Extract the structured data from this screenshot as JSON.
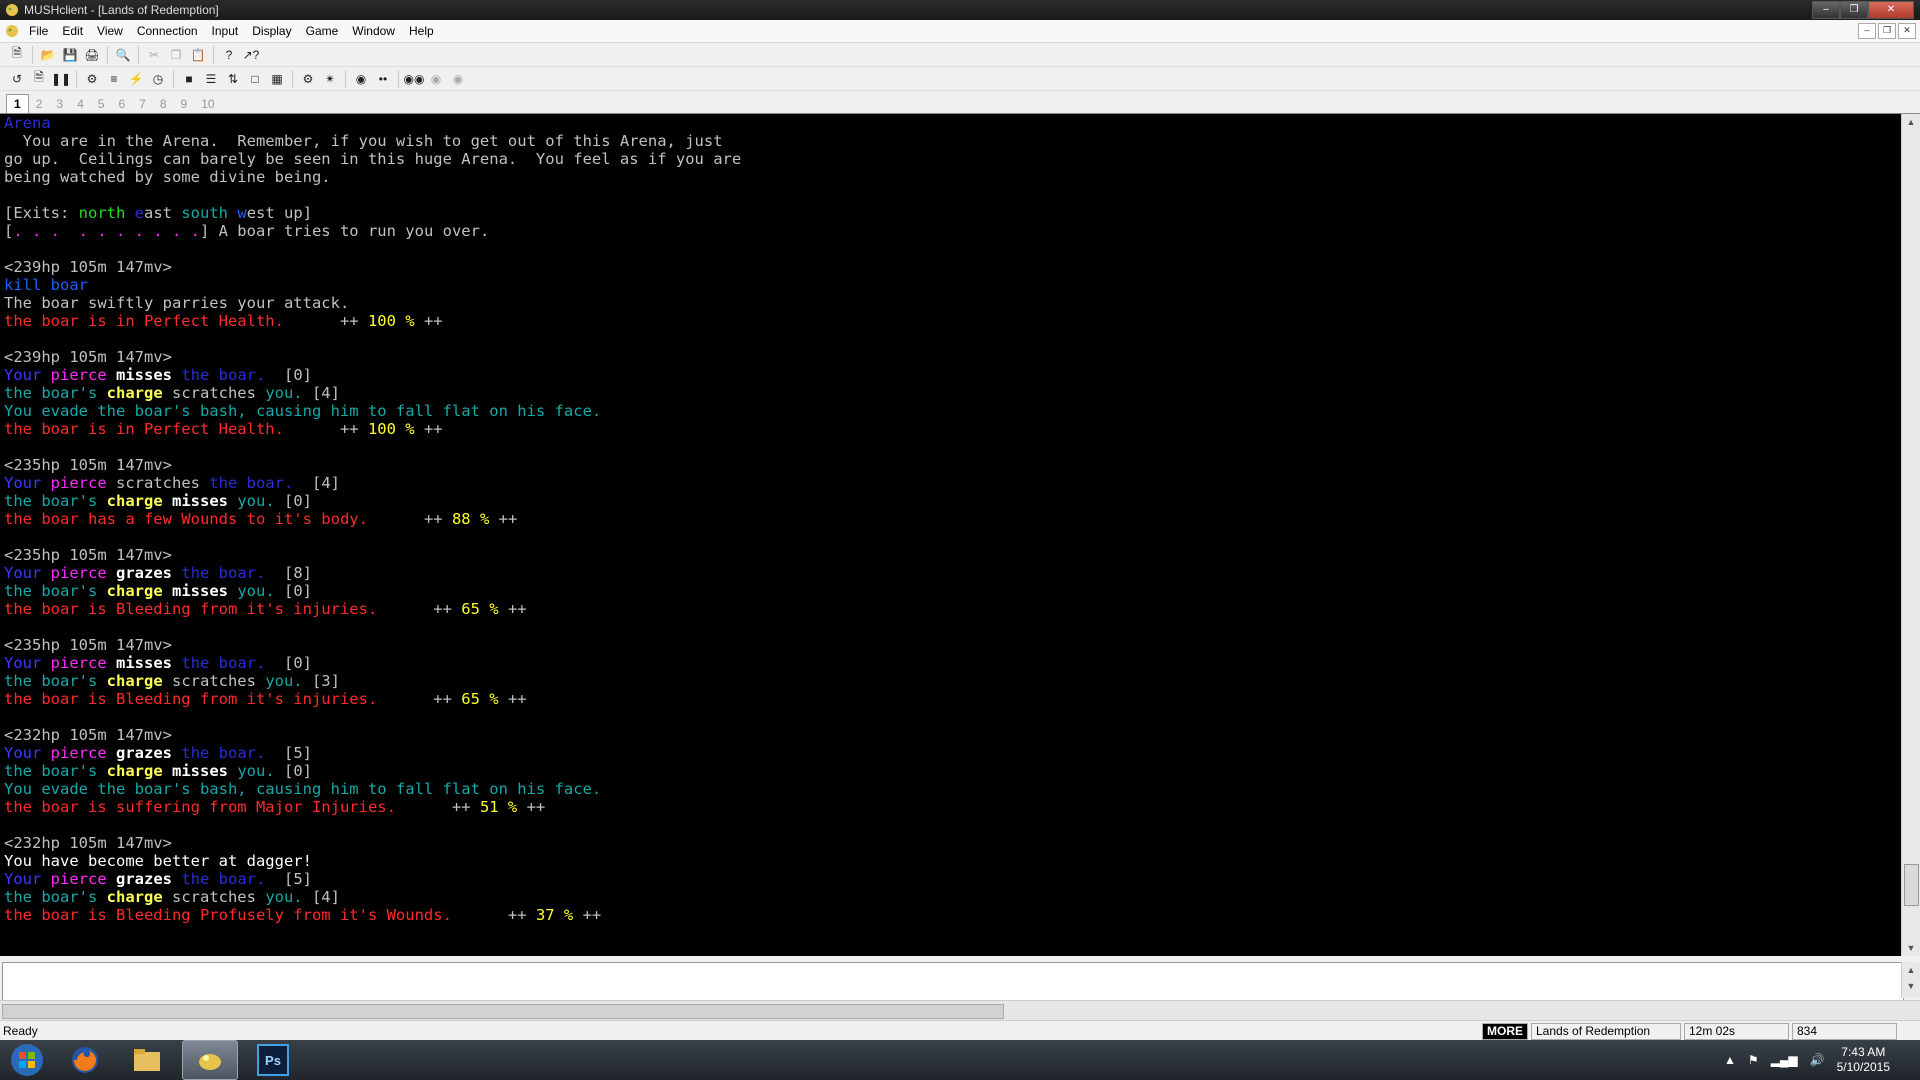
{
  "window": {
    "title": "MUSHclient - [Lands of Redemption]"
  },
  "menu": [
    "File",
    "Edit",
    "View",
    "Connection",
    "Input",
    "Display",
    "Game",
    "Window",
    "Help"
  ],
  "tabs": [
    "1",
    "2",
    "3",
    "4",
    "5",
    "6",
    "7",
    "8",
    "9",
    "10"
  ],
  "output_lines": [
    [
      [
        "Arena",
        "db"
      ]
    ],
    [
      [
        "  You are in the Arena.  Remember, if you wish to get out of this Arena, just",
        "w"
      ]
    ],
    [
      [
        "go up.  Ceilings can barely be seen in this huge Arena.  You feel as if you are",
        "w"
      ]
    ],
    [
      [
        "being watched by some divine being.",
        "w"
      ]
    ],
    [
      [
        "",
        ""
      ]
    ],
    [
      [
        "[Exits: ",
        "w"
      ],
      [
        "north",
        "g"
      ],
      [
        " ",
        "w"
      ],
      [
        "e",
        "db"
      ],
      [
        "ast ",
        "w"
      ],
      [
        "south",
        "c"
      ],
      [
        " ",
        "w"
      ],
      [
        "w",
        "b"
      ],
      [
        "est up]",
        "w"
      ]
    ],
    [
      [
        "[",
        "w"
      ],
      [
        ". . .  . . . . . . .",
        "m"
      ],
      [
        "] A boar tries to run you over.",
        "w"
      ]
    ],
    [
      [
        "",
        ""
      ]
    ],
    [
      [
        "<239hp 105m 147mv>",
        "w"
      ]
    ],
    [
      [
        "kill boar",
        "b"
      ]
    ],
    [
      [
        "The boar swiftly parries your attack.",
        "w"
      ]
    ],
    [
      [
        "the boar is in Perfect Health.",
        "r"
      ],
      [
        "      ++ ",
        "w"
      ],
      [
        "100 %",
        "y"
      ],
      [
        " ++",
        "w"
      ]
    ],
    [
      [
        "",
        ""
      ]
    ],
    [
      [
        "<239hp 105m 147mv>",
        "w"
      ]
    ],
    [
      [
        "Your ",
        "B"
      ],
      [
        "pierce",
        "m"
      ],
      [
        " ",
        "w"
      ],
      [
        "misses",
        "bw"
      ],
      [
        " ",
        "w"
      ],
      [
        "the boar.",
        "db"
      ],
      [
        "  [0]",
        "w"
      ]
    ],
    [
      [
        "the boar's ",
        "c"
      ],
      [
        "charge",
        "yw"
      ],
      [
        " scratches ",
        "w"
      ],
      [
        "you.",
        "c"
      ],
      [
        " [4]",
        "w"
      ]
    ],
    [
      [
        "You evade the boar's bash, causing him to fall flat on his face.",
        "c"
      ]
    ],
    [
      [
        "the boar is in Perfect Health.",
        "r"
      ],
      [
        "      ++ ",
        "w"
      ],
      [
        "100 %",
        "y"
      ],
      [
        " ++",
        "w"
      ]
    ],
    [
      [
        "",
        ""
      ]
    ],
    [
      [
        "<235hp 105m 147mv>",
        "w"
      ]
    ],
    [
      [
        "Your ",
        "B"
      ],
      [
        "pierce",
        "m"
      ],
      [
        " scratches ",
        "w"
      ],
      [
        "the boar.",
        "db"
      ],
      [
        "  [4]",
        "w"
      ]
    ],
    [
      [
        "the boar's ",
        "c"
      ],
      [
        "charge",
        "yw"
      ],
      [
        " ",
        "w"
      ],
      [
        "misses",
        "bw"
      ],
      [
        " ",
        "w"
      ],
      [
        "you.",
        "c"
      ],
      [
        " [0]",
        "w"
      ]
    ],
    [
      [
        "the boar has a few Wounds to it's body.",
        "r"
      ],
      [
        "      ++ ",
        "w"
      ],
      [
        "88 %",
        "y"
      ],
      [
        " ++",
        "w"
      ]
    ],
    [
      [
        "",
        ""
      ]
    ],
    [
      [
        "<235hp 105m 147mv>",
        "w"
      ]
    ],
    [
      [
        "Your ",
        "B"
      ],
      [
        "pierce",
        "m"
      ],
      [
        " ",
        "w"
      ],
      [
        "grazes",
        "bw"
      ],
      [
        " ",
        "w"
      ],
      [
        "the boar.",
        "db"
      ],
      [
        "  [8]",
        "w"
      ]
    ],
    [
      [
        "the boar's ",
        "c"
      ],
      [
        "charge",
        "yw"
      ],
      [
        " ",
        "w"
      ],
      [
        "misses",
        "bw"
      ],
      [
        " ",
        "w"
      ],
      [
        "you.",
        "c"
      ],
      [
        " [0]",
        "w"
      ]
    ],
    [
      [
        "the boar is Bleeding from it's injuries.",
        "r"
      ],
      [
        "      ++ ",
        "w"
      ],
      [
        "65 %",
        "y"
      ],
      [
        " ++",
        "w"
      ]
    ],
    [
      [
        "",
        ""
      ]
    ],
    [
      [
        "<235hp 105m 147mv>",
        "w"
      ]
    ],
    [
      [
        "Your ",
        "B"
      ],
      [
        "pierce",
        "m"
      ],
      [
        " ",
        "w"
      ],
      [
        "misses",
        "bw"
      ],
      [
        " ",
        "w"
      ],
      [
        "the boar.",
        "db"
      ],
      [
        "  [0]",
        "w"
      ]
    ],
    [
      [
        "the boar's ",
        "c"
      ],
      [
        "charge",
        "yw"
      ],
      [
        " scratches ",
        "w"
      ],
      [
        "you.",
        "c"
      ],
      [
        " [3]",
        "w"
      ]
    ],
    [
      [
        "the boar is Bleeding from it's injuries.",
        "r"
      ],
      [
        "      ++ ",
        "w"
      ],
      [
        "65 %",
        "y"
      ],
      [
        " ++",
        "w"
      ]
    ],
    [
      [
        "",
        ""
      ]
    ],
    [
      [
        "<232hp 105m 147mv>",
        "w"
      ]
    ],
    [
      [
        "Your ",
        "B"
      ],
      [
        "pierce",
        "m"
      ],
      [
        " ",
        "w"
      ],
      [
        "grazes",
        "bw"
      ],
      [
        " ",
        "w"
      ],
      [
        "the boar.",
        "db"
      ],
      [
        "  [5]",
        "w"
      ]
    ],
    [
      [
        "the boar's ",
        "c"
      ],
      [
        "charge",
        "yw"
      ],
      [
        " ",
        "w"
      ],
      [
        "misses",
        "bw"
      ],
      [
        " ",
        "w"
      ],
      [
        "you.",
        "c"
      ],
      [
        " [0]",
        "w"
      ]
    ],
    [
      [
        "You evade the boar's bash, causing him to fall flat on his face.",
        "c"
      ]
    ],
    [
      [
        "the boar is suffering from Major Injuries.",
        "r"
      ],
      [
        "      ++ ",
        "w"
      ],
      [
        "51 %",
        "y"
      ],
      [
        " ++",
        "w"
      ]
    ],
    [
      [
        "",
        ""
      ]
    ],
    [
      [
        "<232hp 105m 147mv>",
        "w"
      ]
    ],
    [
      [
        "You have become better at dagger!",
        "W"
      ]
    ],
    [
      [
        "Your ",
        "B"
      ],
      [
        "pierce",
        "m"
      ],
      [
        " ",
        "w"
      ],
      [
        "grazes",
        "bw"
      ],
      [
        " ",
        "w"
      ],
      [
        "the boar.",
        "db"
      ],
      [
        "  [5]",
        "w"
      ]
    ],
    [
      [
        "the boar's ",
        "c"
      ],
      [
        "charge",
        "yw"
      ],
      [
        " scratches ",
        "w"
      ],
      [
        "you.",
        "c"
      ],
      [
        " [4]",
        "w"
      ]
    ],
    [
      [
        "the boar is Bleeding Profusely from it's Wounds.",
        "r"
      ],
      [
        "      ++ ",
        "w"
      ],
      [
        "37 %",
        "y"
      ],
      [
        " ++",
        "w"
      ]
    ]
  ],
  "input": {
    "value": ""
  },
  "status": {
    "ready": "Ready",
    "more": "MORE",
    "world": "Lands of Redemption",
    "time": "12m 02s",
    "lines": "834"
  },
  "taskbar": {
    "items": [
      "start-orb-icon",
      "firefox-icon",
      "folder-icon",
      "mushclient-icon",
      "photoshop-icon"
    ],
    "photoshop_label": "Ps",
    "clock_time": "7:43 AM",
    "clock_date": "5/10/2015"
  }
}
